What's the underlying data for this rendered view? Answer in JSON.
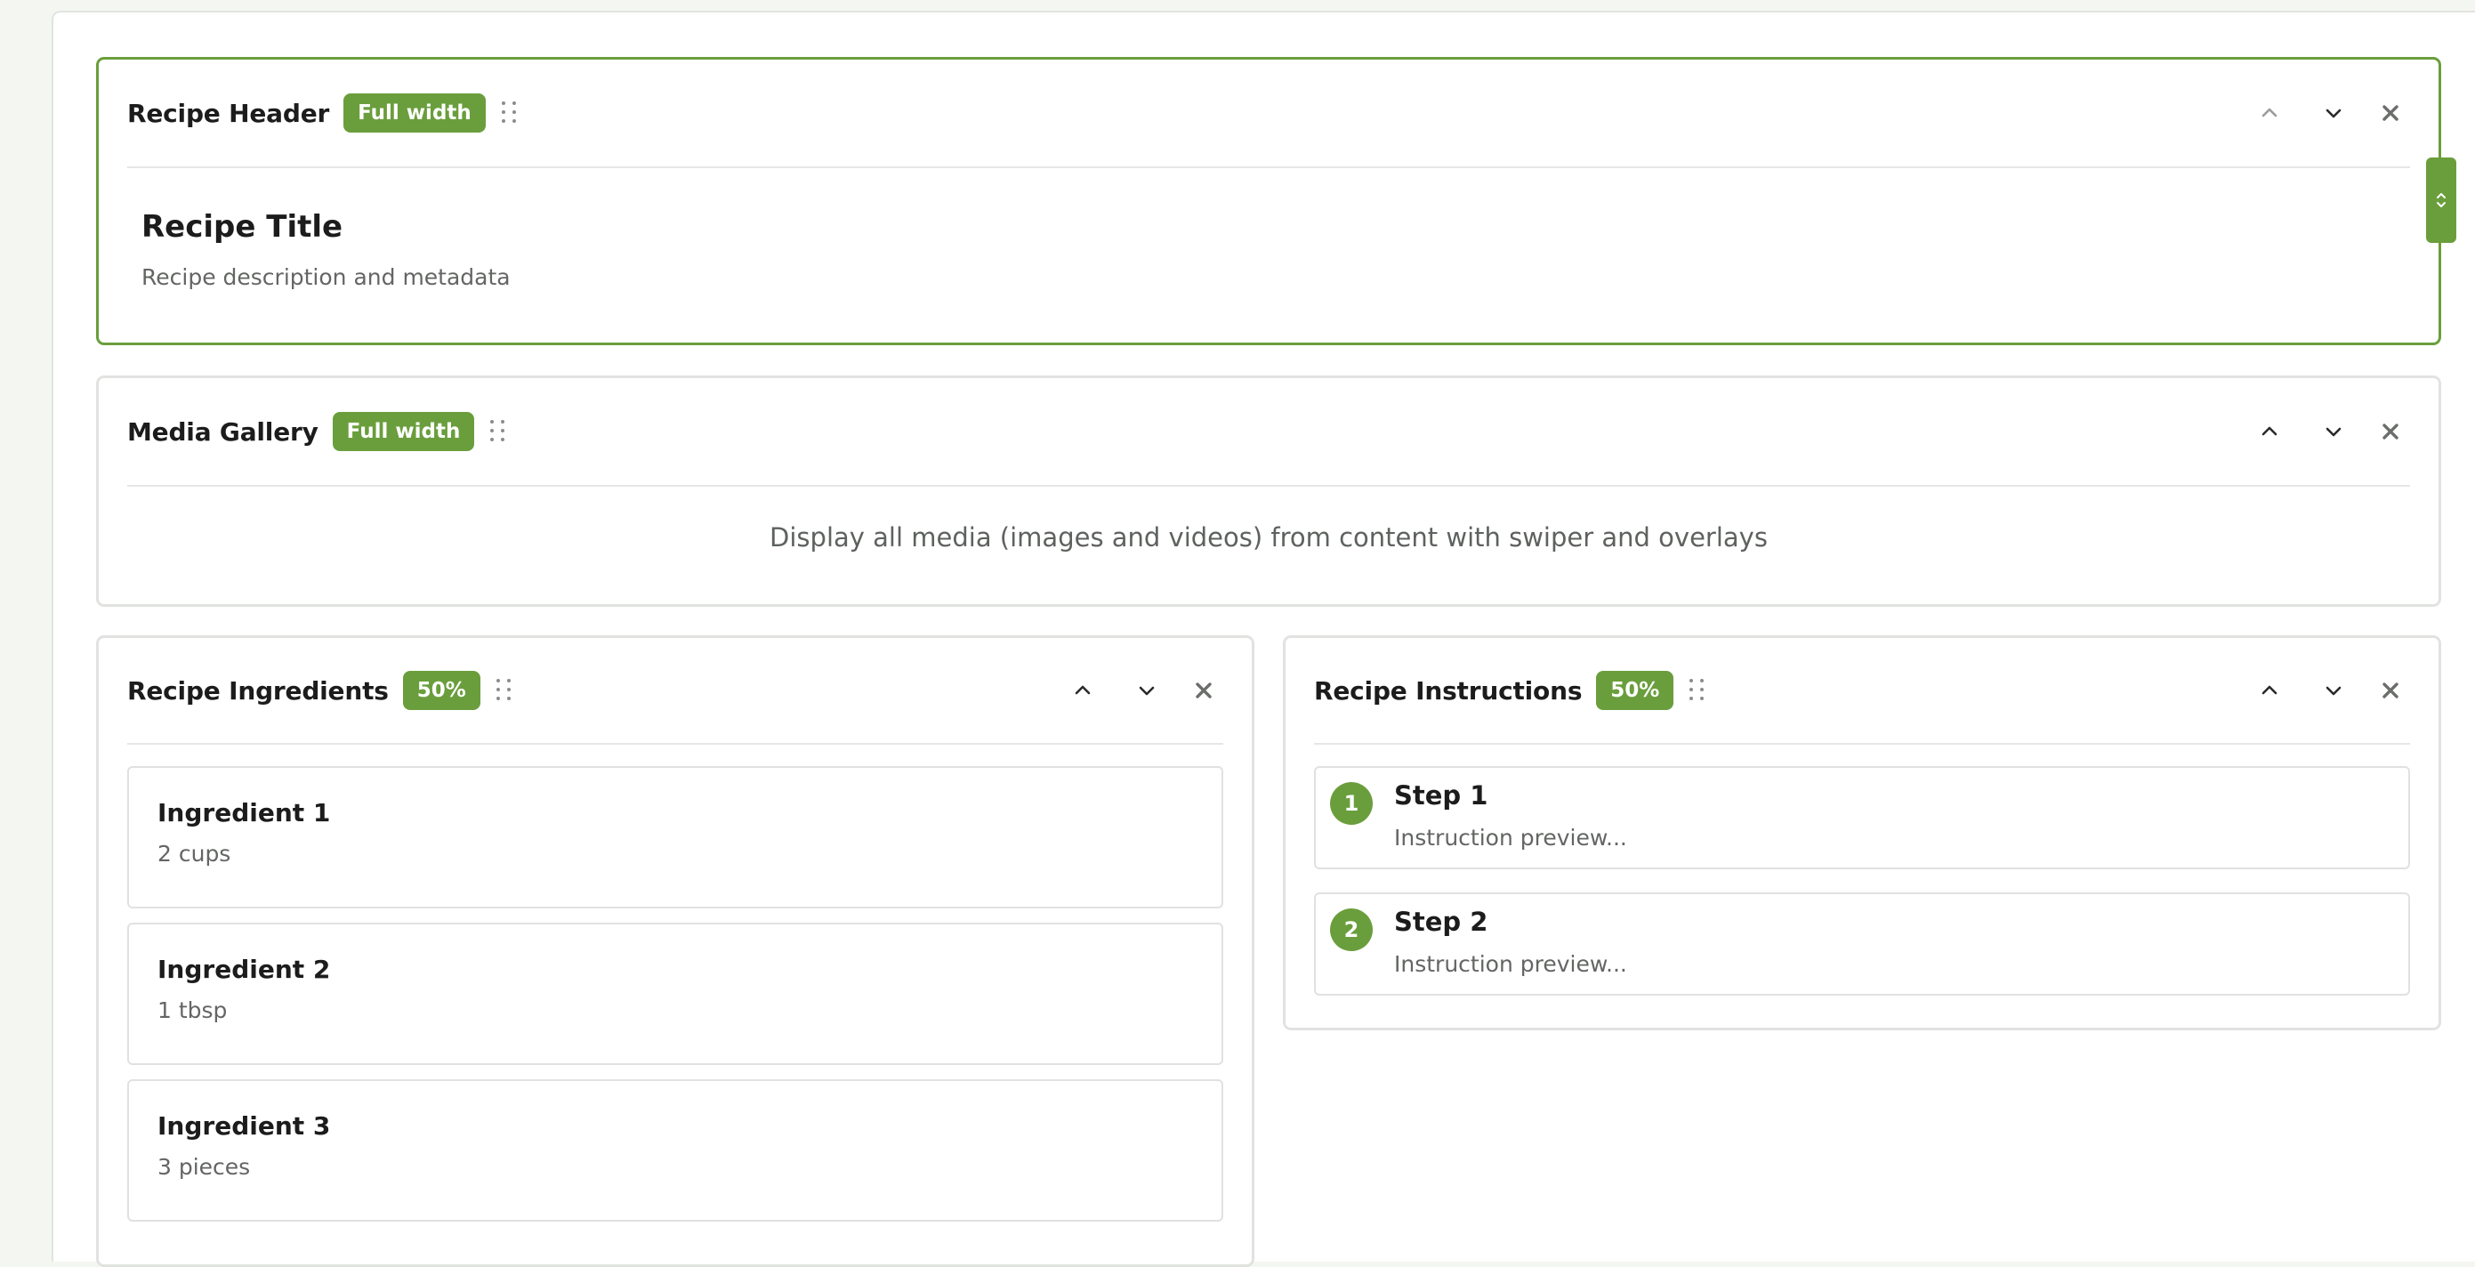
{
  "colors": {
    "accent": "#6a9e3c",
    "border": "#e1e3e0",
    "text": "#1c1c1c",
    "muted": "#636663"
  },
  "blocks": {
    "recipe_header": {
      "title": "Recipe Header",
      "badge": "Full width",
      "content_title": "Recipe Title",
      "content_desc": "Recipe description and metadata"
    },
    "media_gallery": {
      "title": "Media Gallery",
      "badge": "Full width",
      "description": "Display all media (images and videos) from content with swiper and overlays"
    },
    "recipe_ingredients": {
      "title": "Recipe Ingredients",
      "badge": "50%",
      "items": [
        {
          "name": "Ingredient 1",
          "amount": "2 cups"
        },
        {
          "name": "Ingredient 2",
          "amount": "1 tbsp"
        },
        {
          "name": "Ingredient 3",
          "amount": "3 pieces"
        }
      ]
    },
    "recipe_instructions": {
      "title": "Recipe Instructions",
      "badge": "50%",
      "steps": [
        {
          "number": "1",
          "title": "Step 1",
          "preview": "Instruction preview..."
        },
        {
          "number": "2",
          "title": "Step 2",
          "preview": "Instruction preview..."
        }
      ]
    }
  },
  "icons": {
    "drag": "drag-handle-icon",
    "up": "chevron-up-icon",
    "down": "chevron-down-icon",
    "remove": "close-icon",
    "resize": "resize-vertical-icon"
  }
}
